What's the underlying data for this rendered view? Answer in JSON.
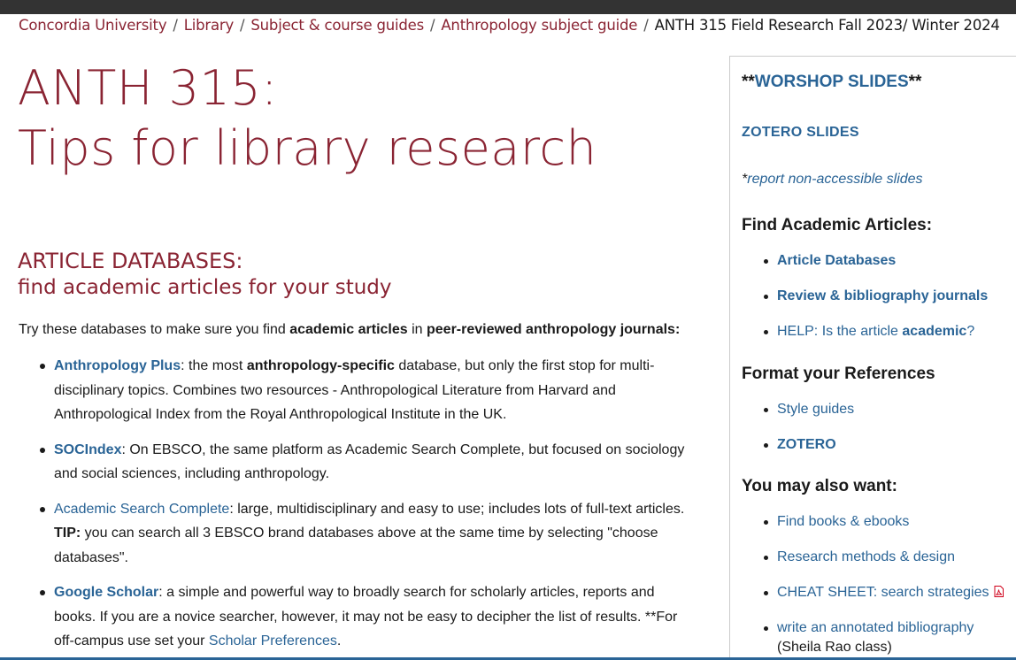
{
  "colors": {
    "maroon": "#8a2433",
    "link": "#2a6496",
    "topbar": "#333333"
  },
  "breadcrumb": {
    "items": [
      "Concordia University",
      "Library",
      "Subject & course guides",
      "Anthropology subject guide"
    ],
    "current": "ANTH 315 Field Research Fall 2023/ Winter 2024",
    "separator": "/"
  },
  "page_title": {
    "line1": "ANTH 315:",
    "line2": "Tips for library research"
  },
  "section": {
    "heading_line1": "ARTICLE DATABASES:",
    "heading_line2": "find academic articles for your study",
    "intro_pre": "Try these databases to make sure you find ",
    "intro_b1": "academic articles",
    "intro_mid": " in ",
    "intro_b2": "peer-reviewed anthropology journals:"
  },
  "databases": [
    {
      "name": "Anthropology Plus",
      "t1": ": the most ",
      "bold": "anthropology-specific",
      "t2": " database, but only the first stop for multi-disciplinary topics. Combines two resources - Anthropological Literature from Harvard and Anthropological Index from the Royal Anthropological Institute in the UK."
    },
    {
      "name": "SOCIndex",
      "t1": ": On EBSCO, the same platform as Academic Search Complete, but focused on sociology and social sciences, including anthropology."
    },
    {
      "name": "Academic Search Complete",
      "t1": ": large, multidisciplinary and easy to use; includes lots of full-text articles.",
      "tip_label": "TIP:",
      "tip_text": " you can search all 3 EBSCO brand databases above at the same time by selecting \"choose databases\"."
    },
    {
      "name": "Google Scholar",
      "t1": ": a simple and powerful way to broadly search for scholarly articles, reports and books. If you are a novice searcher, however, it may not be easy to decipher the list of results. **For off-campus use set your ",
      "link2": "Scholar Preferences",
      "t2": "."
    }
  ],
  "sidebar": {
    "slides_prefix": "**",
    "slides_link": "WORSHOP SLIDES",
    "slides_suffix": "**",
    "zotero_slides": "ZOTERO SLIDES",
    "report_star": "*",
    "report_link": "report non-accessible slides",
    "find_heading": "Find Academic Articles:",
    "find_items": {
      "article_databases": "Article Databases",
      "review_journals": "Review & bibliography journals",
      "help_pre": "HELP: Is the article ",
      "help_bold": "academic",
      "help_post": "?"
    },
    "format_heading": "Format your References",
    "format_items": {
      "style_guides": "Style guides",
      "zotero": "ZOTERO"
    },
    "also_heading": "You may also want:",
    "also_items": {
      "books": "Find books & ebooks",
      "methods": "Research methods & design",
      "cheat": "CHEAT SHEET: search strategies",
      "annotated": "write an annotated bibliography",
      "annotated_note": "(Sheila Rao class)"
    }
  }
}
